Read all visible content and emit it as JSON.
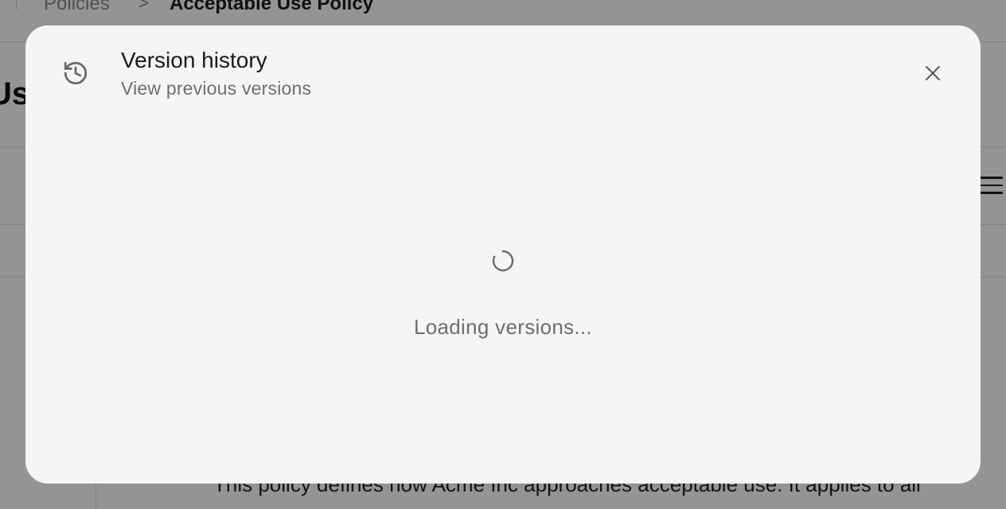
{
  "background": {
    "breadcrumb": {
      "parent": "Policies",
      "separator": ">",
      "current": "Acceptable Use Policy"
    },
    "page_title": "Use",
    "body_text": "This policy defines how Acme Inc approaches acceptable use. It applies to all",
    "menu_icon": "hamburger-menu-icon"
  },
  "modal": {
    "icon": "history-icon",
    "title": "Version history",
    "subtitle": "View previous versions",
    "close_icon": "close-icon",
    "loading": {
      "icon": "spinner-icon",
      "text": "Loading versions..."
    }
  },
  "colors": {
    "overlay": "rgba(0,0,0,0.42)",
    "modal_bg": "#f5f5f5",
    "title": "#1a1a1a",
    "muted": "#6e6e6e"
  }
}
